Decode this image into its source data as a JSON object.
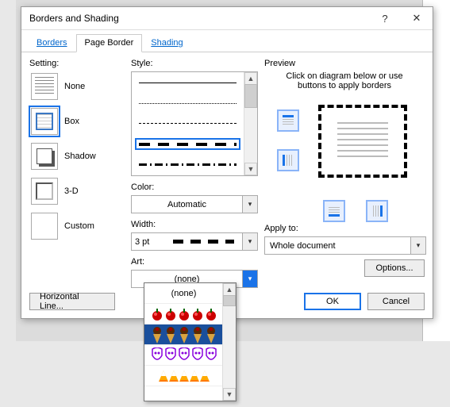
{
  "titlebar": {
    "title": "Borders and Shading"
  },
  "tabs": {
    "borders": "Borders",
    "page_border": "Page Border",
    "shading": "Shading"
  },
  "setting": {
    "label": "Setting:",
    "none": "None",
    "box": "Box",
    "shadow": "Shadow",
    "threeD": "3-D",
    "custom": "Custom"
  },
  "style": {
    "label": "Style:",
    "color_label": "Color:",
    "color_value": "Automatic",
    "width_label": "Width:",
    "width_value": "3 pt",
    "art_label": "Art:",
    "art_value": "(none)"
  },
  "preview": {
    "label": "Preview",
    "hint": "Click on diagram below or use buttons to apply borders",
    "apply_label": "Apply to:",
    "apply_value": "Whole document",
    "options": "Options..."
  },
  "buttons": {
    "ok": "OK",
    "cancel": "Cancel",
    "hline": "Horizontal Line..."
  },
  "art_popup": {
    "none": "(none)"
  }
}
